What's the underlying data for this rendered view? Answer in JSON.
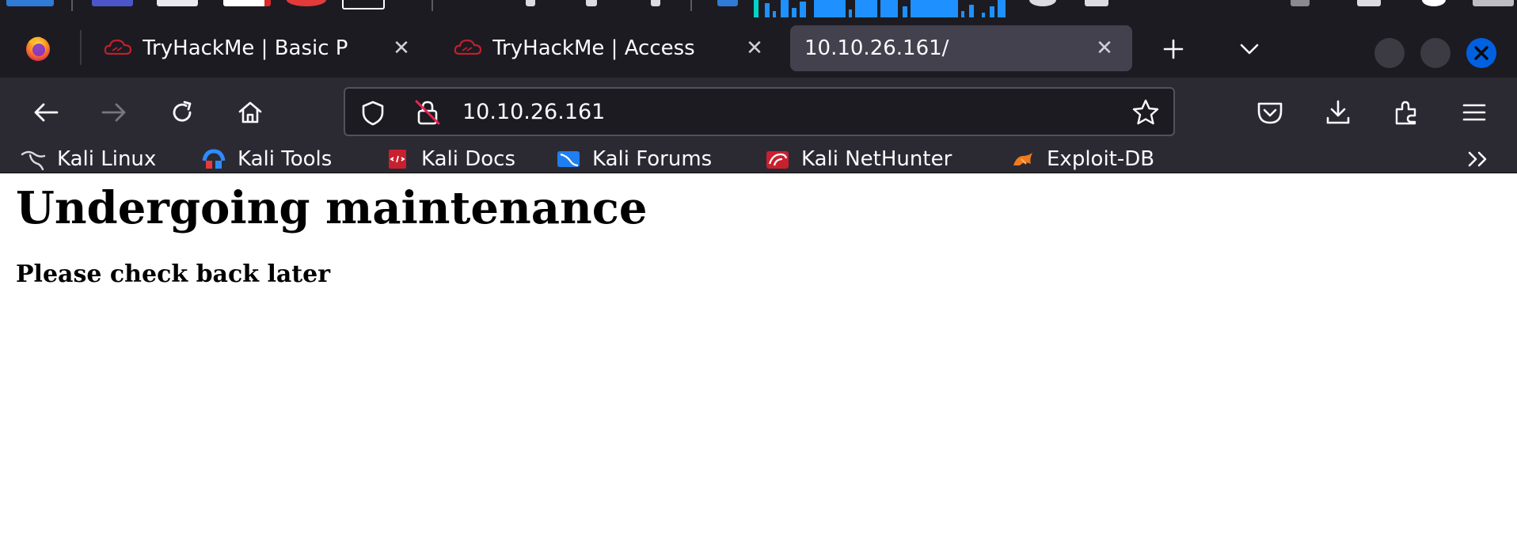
{
  "browser": {
    "tabs": [
      {
        "title": "TryHackMe | Basic P",
        "state": "inactive"
      },
      {
        "title": "TryHackMe | Access",
        "state": "inactive"
      },
      {
        "title": "10.10.26.161/",
        "state": "active"
      }
    ],
    "url": "10.10.26.161",
    "bookmarks": [
      {
        "label": "Kali Linux",
        "icon": "kali-dragon-icon"
      },
      {
        "label": "Kali Tools",
        "icon": "kali-tools-icon"
      },
      {
        "label": "Kali Docs",
        "icon": "kali-docs-icon"
      },
      {
        "label": "Kali Forums",
        "icon": "kali-forums-icon"
      },
      {
        "label": "Kali NetHunter",
        "icon": "kali-nethunter-icon"
      },
      {
        "label": "Exploit-DB",
        "icon": "exploit-db-icon"
      }
    ]
  },
  "page": {
    "heading": "Undergoing maintenance",
    "subheading": "Please check back later"
  },
  "colors": {
    "chrome_dark": "#1c1b22",
    "toolbar": "#2b2a33",
    "active_tab": "#42414d",
    "close_button_accent": "#0061e0",
    "tryhackme_red": "#c11f2a"
  }
}
